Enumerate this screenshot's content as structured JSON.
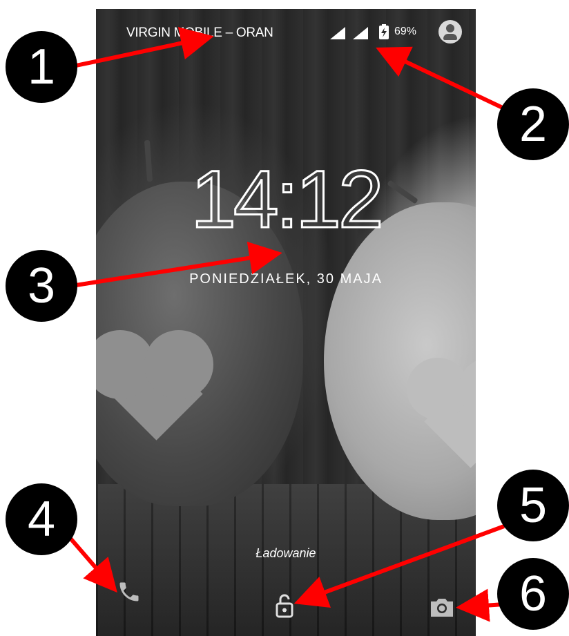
{
  "status_bar": {
    "carrier": "VIRGIN MOBILE – ORAN",
    "battery_percent": "69%",
    "battery_charging": true
  },
  "lock_screen": {
    "time": "14:12",
    "date": "PONIEDZIAŁEK, 30 MAJA",
    "charging_label": "Ładowanie"
  },
  "bottom_actions": {
    "left": "phone-icon",
    "center": "lock-icon",
    "right": "camera-icon"
  },
  "callouts": [
    "1",
    "2",
    "3",
    "4",
    "5",
    "6"
  ],
  "colors": {
    "arrow": "#ff0000",
    "callout_bg": "#000000",
    "callout_text": "#ffffff"
  }
}
